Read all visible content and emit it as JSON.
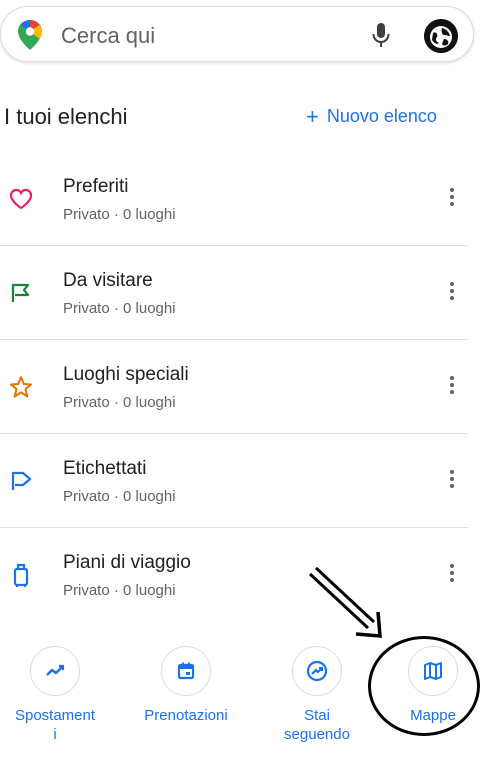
{
  "search": {
    "placeholder": "Cerca qui"
  },
  "header": {
    "title": "I tuoi elenchi",
    "new_list_label": "Nuovo elenco",
    "new_list_icon": "plus-icon"
  },
  "lists": [
    {
      "name": "Preferiti",
      "subtitle": "Privato · 0 luoghi",
      "icon": "heart-icon",
      "color": "#e91e63"
    },
    {
      "name": "Da visitare",
      "subtitle": "Privato · 0 luoghi",
      "icon": "flag-icon",
      "color": "#188038"
    },
    {
      "name": "Luoghi speciali",
      "subtitle": "Privato · 0 luoghi",
      "icon": "star-icon",
      "color": "#e37400"
    },
    {
      "name": "Etichettati",
      "subtitle": "Privato · 0 luoghi",
      "icon": "label-flag-icon",
      "color": "#1a73e8"
    },
    {
      "name": "Piani di viaggio",
      "subtitle": "Privato · 0 luoghi",
      "icon": "luggage-icon",
      "color": "#1a73e8"
    }
  ],
  "bottom_nav": [
    {
      "label": "Spostament\ni",
      "icon": "trending-icon"
    },
    {
      "label": "Prenotazioni",
      "icon": "calendar-icon"
    },
    {
      "label": "Stai\nseguendo",
      "icon": "following-icon"
    },
    {
      "label": "Mappe",
      "icon": "map-icon"
    }
  ],
  "colors": {
    "accent": "#1a73e8",
    "text": "#202124",
    "secondary_text": "#5f6368",
    "divider": "#e0e0e0"
  }
}
